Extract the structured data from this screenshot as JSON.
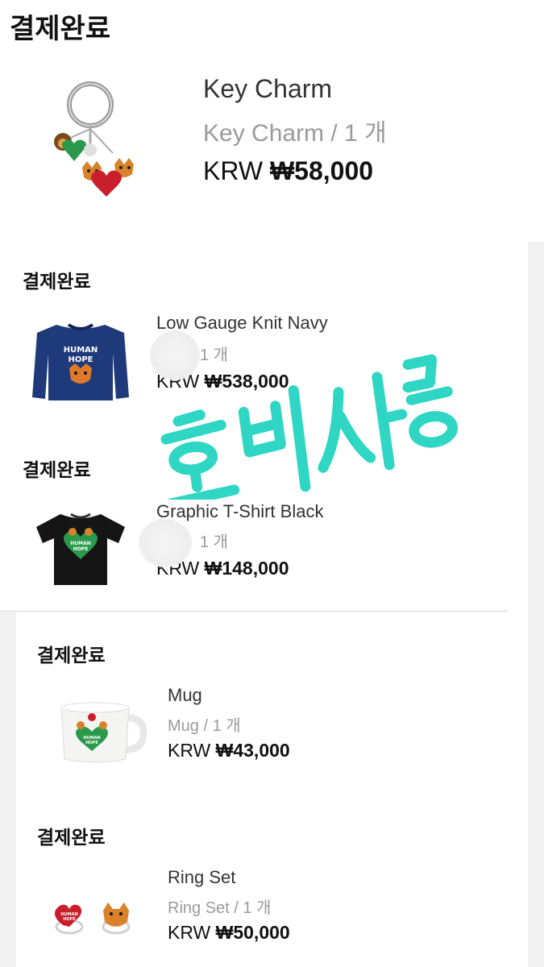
{
  "orders": [
    {
      "status": "결제완료",
      "name": "Key Charm",
      "detail": "Key Charm / 1 개",
      "currency": "KRW",
      "price": "₩58,000",
      "thumb": "keyring-image"
    },
    {
      "status": "결제완료",
      "name": "Low Gauge Knit Navy",
      "detail": "1 개",
      "currency": "KRW",
      "price": "₩538,000",
      "thumb": "navy-knit-sweater-image"
    },
    {
      "status": "결제완료",
      "name": "Graphic T-Shirt Black",
      "detail": "1 개",
      "currency": "KRW",
      "price": "₩148,000",
      "thumb": "black-tshirt-image"
    },
    {
      "status": "결제완료",
      "name": "Mug",
      "detail": "Mug / 1 개",
      "currency": "KRW",
      "price": "₩43,000",
      "thumb": "mug-image"
    },
    {
      "status": "결제완료",
      "name": "Ring Set",
      "detail": "Ring Set / 1 개",
      "currency": "KRW",
      "price": "₩50,000",
      "thumb": "ring-set-image"
    }
  ],
  "watermark": {
    "text": "호비사랑",
    "color": "#2fd6c3"
  },
  "colors": {
    "status_text": "#111111",
    "name_text": "#333333",
    "detail_text": "#9a9a9a",
    "price_text": "#111111"
  }
}
